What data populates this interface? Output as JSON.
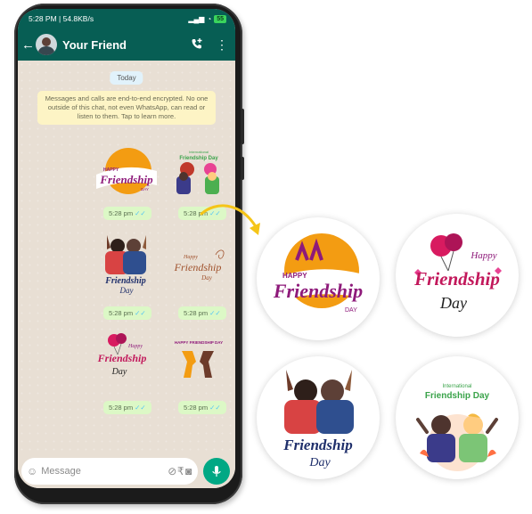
{
  "status_bar": {
    "time_speed": "5:28 PM | 54.8KB/s",
    "battery": "55"
  },
  "header": {
    "contact_name": "Your Friend"
  },
  "chat": {
    "date_chip": "Today",
    "encryption_notice": "Messages and calls are end-to-end encrypted. No one outside of this chat, not even WhatsApp, can read or listen to them. Tap to learn more.",
    "stickers": [
      {
        "name": "sticker-happy-friendship-day-orange",
        "time": "5:28 pm"
      },
      {
        "name": "sticker-international-friendship-day",
        "time": "5:28 pm"
      },
      {
        "name": "sticker-friends-hugging",
        "time": "5:28 pm"
      },
      {
        "name": "sticker-friendship-day-script",
        "time": "5:28 pm"
      },
      {
        "name": "sticker-friendship-day-balloons",
        "time": "5:28 pm"
      },
      {
        "name": "sticker-happy-friendship-day-hands",
        "time": "5:28 pm"
      }
    ]
  },
  "composer": {
    "placeholder": "Message"
  },
  "sticker_text": {
    "happy": "HAPPY",
    "friendship": "Friendship",
    "day_caps": "DAY",
    "happy_script": "Happy",
    "day_script": "Day",
    "international": "International",
    "friendship_day": "Friendship Day",
    "happy_friendship_caps": "HAPPY FRIENDSHIP DAY"
  },
  "colors": {
    "whatsapp_green": "#075e54",
    "accent_green": "#00a884",
    "bubble_green": "#dcf8c6",
    "sticker_purple": "#8e1a7a",
    "sticker_orange": "#f39c12",
    "arrow_yellow": "#f5c518"
  }
}
